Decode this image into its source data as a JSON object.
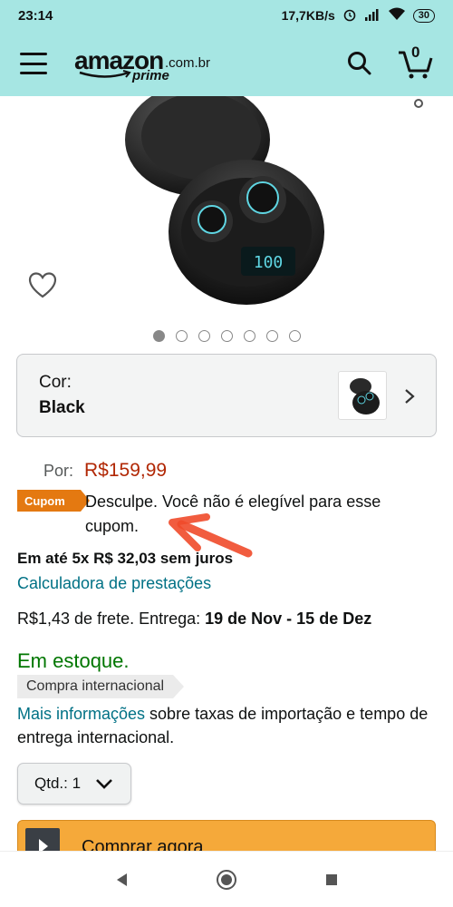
{
  "status_bar": {
    "time": "23:14",
    "network_speed": "17,7KB/s",
    "battery": "30"
  },
  "header": {
    "logo_text": "amazon",
    "logo_domain": ".com.br",
    "logo_sub": "prime",
    "cart_count": "0"
  },
  "gallery": {
    "image_count": 7,
    "active_index": 0
  },
  "color_selector": {
    "label": "Cor:",
    "value": "Black"
  },
  "price": {
    "label": "Por:",
    "value": "R$159,99"
  },
  "coupon": {
    "badge": "Cupom",
    "message": "Desculpe. Você não é elegível para esse cupom."
  },
  "installments": "Em até 5x R$ 32,03 sem juros",
  "calculator_link": "Calculadora de prestações",
  "shipping": {
    "prefix": "R$1,43 de frete. Entrega: ",
    "dates": "19 de Nov - 15 de Dez"
  },
  "stock": "Em estoque.",
  "intl_badge": "Compra internacional",
  "more_info": {
    "link": "Mais informações",
    "text": " sobre taxas de importação e tempo de entrega internacional."
  },
  "quantity": {
    "label": "Qtd.:",
    "value": "1"
  },
  "buy_button": "Comprar agora",
  "colors": {
    "header_bg": "#a6e6e3",
    "price": "#b12704",
    "link": "#007185",
    "stock": "#007600",
    "coupon": "#e47911",
    "buy": "#f5a93a"
  }
}
